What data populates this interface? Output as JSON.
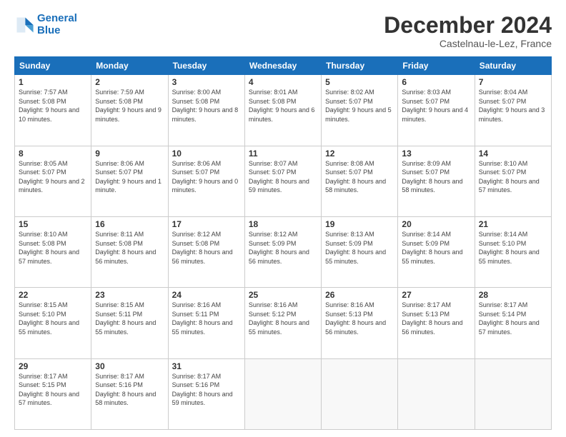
{
  "logo": {
    "line1": "General",
    "line2": "Blue"
  },
  "title": "December 2024",
  "subtitle": "Castelnau-le-Lez, France",
  "weekdays": [
    "Sunday",
    "Monday",
    "Tuesday",
    "Wednesday",
    "Thursday",
    "Friday",
    "Saturday"
  ],
  "weeks": [
    [
      {
        "day": 1,
        "info": "Sunrise: 7:57 AM\nSunset: 5:08 PM\nDaylight: 9 hours and 10 minutes."
      },
      {
        "day": 2,
        "info": "Sunrise: 7:59 AM\nSunset: 5:08 PM\nDaylight: 9 hours and 9 minutes."
      },
      {
        "day": 3,
        "info": "Sunrise: 8:00 AM\nSunset: 5:08 PM\nDaylight: 9 hours and 8 minutes."
      },
      {
        "day": 4,
        "info": "Sunrise: 8:01 AM\nSunset: 5:08 PM\nDaylight: 9 hours and 6 minutes."
      },
      {
        "day": 5,
        "info": "Sunrise: 8:02 AM\nSunset: 5:07 PM\nDaylight: 9 hours and 5 minutes."
      },
      {
        "day": 6,
        "info": "Sunrise: 8:03 AM\nSunset: 5:07 PM\nDaylight: 9 hours and 4 minutes."
      },
      {
        "day": 7,
        "info": "Sunrise: 8:04 AM\nSunset: 5:07 PM\nDaylight: 9 hours and 3 minutes."
      }
    ],
    [
      {
        "day": 8,
        "info": "Sunrise: 8:05 AM\nSunset: 5:07 PM\nDaylight: 9 hours and 2 minutes."
      },
      {
        "day": 9,
        "info": "Sunrise: 8:06 AM\nSunset: 5:07 PM\nDaylight: 9 hours and 1 minute."
      },
      {
        "day": 10,
        "info": "Sunrise: 8:06 AM\nSunset: 5:07 PM\nDaylight: 9 hours and 0 minutes."
      },
      {
        "day": 11,
        "info": "Sunrise: 8:07 AM\nSunset: 5:07 PM\nDaylight: 8 hours and 59 minutes."
      },
      {
        "day": 12,
        "info": "Sunrise: 8:08 AM\nSunset: 5:07 PM\nDaylight: 8 hours and 58 minutes."
      },
      {
        "day": 13,
        "info": "Sunrise: 8:09 AM\nSunset: 5:07 PM\nDaylight: 8 hours and 58 minutes."
      },
      {
        "day": 14,
        "info": "Sunrise: 8:10 AM\nSunset: 5:07 PM\nDaylight: 8 hours and 57 minutes."
      }
    ],
    [
      {
        "day": 15,
        "info": "Sunrise: 8:10 AM\nSunset: 5:08 PM\nDaylight: 8 hours and 57 minutes."
      },
      {
        "day": 16,
        "info": "Sunrise: 8:11 AM\nSunset: 5:08 PM\nDaylight: 8 hours and 56 minutes."
      },
      {
        "day": 17,
        "info": "Sunrise: 8:12 AM\nSunset: 5:08 PM\nDaylight: 8 hours and 56 minutes."
      },
      {
        "day": 18,
        "info": "Sunrise: 8:12 AM\nSunset: 5:09 PM\nDaylight: 8 hours and 56 minutes."
      },
      {
        "day": 19,
        "info": "Sunrise: 8:13 AM\nSunset: 5:09 PM\nDaylight: 8 hours and 55 minutes."
      },
      {
        "day": 20,
        "info": "Sunrise: 8:14 AM\nSunset: 5:09 PM\nDaylight: 8 hours and 55 minutes."
      },
      {
        "day": 21,
        "info": "Sunrise: 8:14 AM\nSunset: 5:10 PM\nDaylight: 8 hours and 55 minutes."
      }
    ],
    [
      {
        "day": 22,
        "info": "Sunrise: 8:15 AM\nSunset: 5:10 PM\nDaylight: 8 hours and 55 minutes."
      },
      {
        "day": 23,
        "info": "Sunrise: 8:15 AM\nSunset: 5:11 PM\nDaylight: 8 hours and 55 minutes."
      },
      {
        "day": 24,
        "info": "Sunrise: 8:16 AM\nSunset: 5:11 PM\nDaylight: 8 hours and 55 minutes."
      },
      {
        "day": 25,
        "info": "Sunrise: 8:16 AM\nSunset: 5:12 PM\nDaylight: 8 hours and 55 minutes."
      },
      {
        "day": 26,
        "info": "Sunrise: 8:16 AM\nSunset: 5:13 PM\nDaylight: 8 hours and 56 minutes."
      },
      {
        "day": 27,
        "info": "Sunrise: 8:17 AM\nSunset: 5:13 PM\nDaylight: 8 hours and 56 minutes."
      },
      {
        "day": 28,
        "info": "Sunrise: 8:17 AM\nSunset: 5:14 PM\nDaylight: 8 hours and 57 minutes."
      }
    ],
    [
      {
        "day": 29,
        "info": "Sunrise: 8:17 AM\nSunset: 5:15 PM\nDaylight: 8 hours and 57 minutes."
      },
      {
        "day": 30,
        "info": "Sunrise: 8:17 AM\nSunset: 5:16 PM\nDaylight: 8 hours and 58 minutes."
      },
      {
        "day": 31,
        "info": "Sunrise: 8:17 AM\nSunset: 5:16 PM\nDaylight: 8 hours and 59 minutes."
      },
      null,
      null,
      null,
      null
    ]
  ]
}
